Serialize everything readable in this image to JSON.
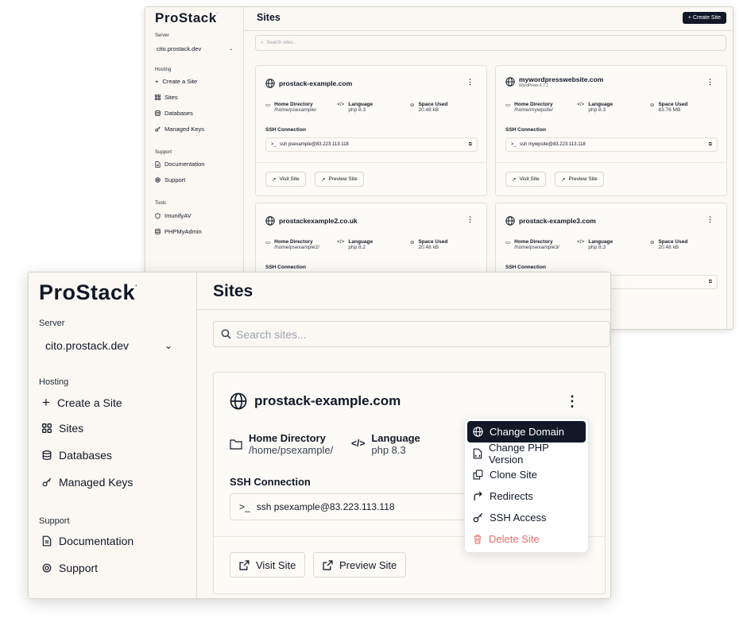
{
  "app": {
    "logo": "ProStack",
    "title": "Sites",
    "create_label": "Create Site"
  },
  "sidebar": {
    "server_label": "Server",
    "server_value": "cito.prostack.dev",
    "hosting_label": "Hosting",
    "hosting_items": [
      {
        "label": "Create a Site",
        "icon": "plus-icon"
      },
      {
        "label": "Sites",
        "icon": "grid-icon"
      },
      {
        "label": "Databases",
        "icon": "database-icon"
      },
      {
        "label": "Managed Keys",
        "icon": "key-icon"
      }
    ],
    "support_label": "Support",
    "support_items": [
      {
        "label": "Documentation",
        "icon": "document-icon"
      },
      {
        "label": "Support",
        "icon": "lifebuoy-icon"
      }
    ],
    "tools_label": "Tools",
    "tools_items": [
      {
        "label": "ImunifyAV",
        "icon": "shield-icon"
      },
      {
        "label": "PHPMyAdmin",
        "icon": "database-icon"
      }
    ]
  },
  "search": {
    "placeholder": "Search sites..."
  },
  "labels": {
    "home_dir": "Home Directory",
    "language": "Language",
    "space_used": "Space Used",
    "ssh": "SSH Connection",
    "visit": "Visit Site",
    "preview": "Preview Site",
    "ssh_prompt": ">_"
  },
  "sites": [
    {
      "domain": "prostack-example.com",
      "subtitle": "",
      "dir": "/home/psexample/",
      "lang": "php 8.3",
      "space": "20.48 kB",
      "ssh": "ssh psexample@83.223.113.118"
    },
    {
      "domain": "mywordpresswebsite.com",
      "subtitle": "WordPress 6.7.1",
      "dir": "/home/mywpsite/",
      "lang": "php 8.3",
      "space": "83.76 MB",
      "ssh": "ssh mywpsite@83.223.113.118"
    },
    {
      "domain": "prostackexample2.co.uk",
      "subtitle": "",
      "dir": "/home/psexample2/",
      "lang": "php 8.2",
      "space": "20.48 kB",
      "ssh": ""
    },
    {
      "domain": "prostack-example3.com",
      "subtitle": "",
      "dir": "/home/psexample3/",
      "lang": "php 8.3",
      "space": "20.48 kB",
      "ssh": ""
    }
  ],
  "menu": {
    "items": [
      {
        "label": "Change Domain",
        "icon": "globe-icon"
      },
      {
        "label": "Change PHP Version",
        "icon": "php-file-icon"
      },
      {
        "label": "Clone Site",
        "icon": "clone-icon"
      },
      {
        "label": "Redirects",
        "icon": "redirect-arrow-icon"
      },
      {
        "label": "SSH Access",
        "icon": "key-icon"
      },
      {
        "label": "Delete Site",
        "icon": "trash-icon"
      }
    ]
  },
  "colors": {
    "sidebar_bg": "#fbf8f3",
    "primary_button": "#111827",
    "danger": "#ef6b6b"
  }
}
